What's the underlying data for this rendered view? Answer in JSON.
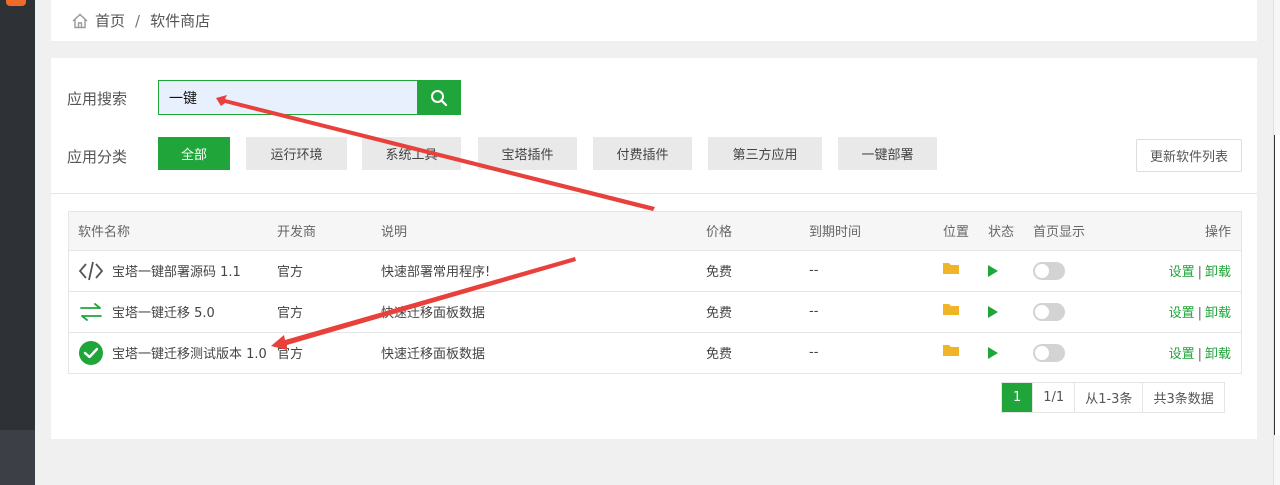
{
  "breadcrumb": {
    "home": "首页",
    "separator": "/",
    "current": "软件商店"
  },
  "search": {
    "label": "应用搜索",
    "value": "一键"
  },
  "categories": {
    "label": "应用分类",
    "items": [
      "全部",
      "运行环境",
      "系统工具",
      "宝塔插件",
      "付费插件",
      "第三方应用",
      "一键部署"
    ],
    "active": "全部"
  },
  "refresh_label": "更新软件列表",
  "table": {
    "headers": [
      "软件名称",
      "开发商",
      "说明",
      "价格",
      "到期时间",
      "位置",
      "状态",
      "首页显示",
      "操作"
    ],
    "rows": [
      {
        "icon": "code-icon",
        "name": "宝塔一键部署源码 1.1",
        "dev": "官方",
        "desc": "快速部署常用程序!",
        "price": "免费",
        "expire": "--",
        "op_settings": "设置",
        "op_sep": "|",
        "op_uninstall": "卸载"
      },
      {
        "icon": "transfer-icon",
        "name": "宝塔一键迁移 5.0",
        "dev": "官方",
        "desc": "快速迁移面板数据",
        "price": "免费",
        "expire": "--",
        "op_settings": "设置",
        "op_sep": "|",
        "op_uninstall": "卸载"
      },
      {
        "icon": "check-circle-icon",
        "name": "宝塔一键迁移测试版本 1.0",
        "dev": "官方",
        "desc": "快速迁移面板数据",
        "price": "免费",
        "expire": "--",
        "op_settings": "设置",
        "op_sep": "|",
        "op_uninstall": "卸载"
      }
    ]
  },
  "pagination": {
    "current": "1",
    "pages": "1/1",
    "range": "从1-3条",
    "total": "共3条数据"
  },
  "colors": {
    "accent": "#20a53a",
    "arrow": "#e8413c",
    "folder": "#f0b429"
  }
}
